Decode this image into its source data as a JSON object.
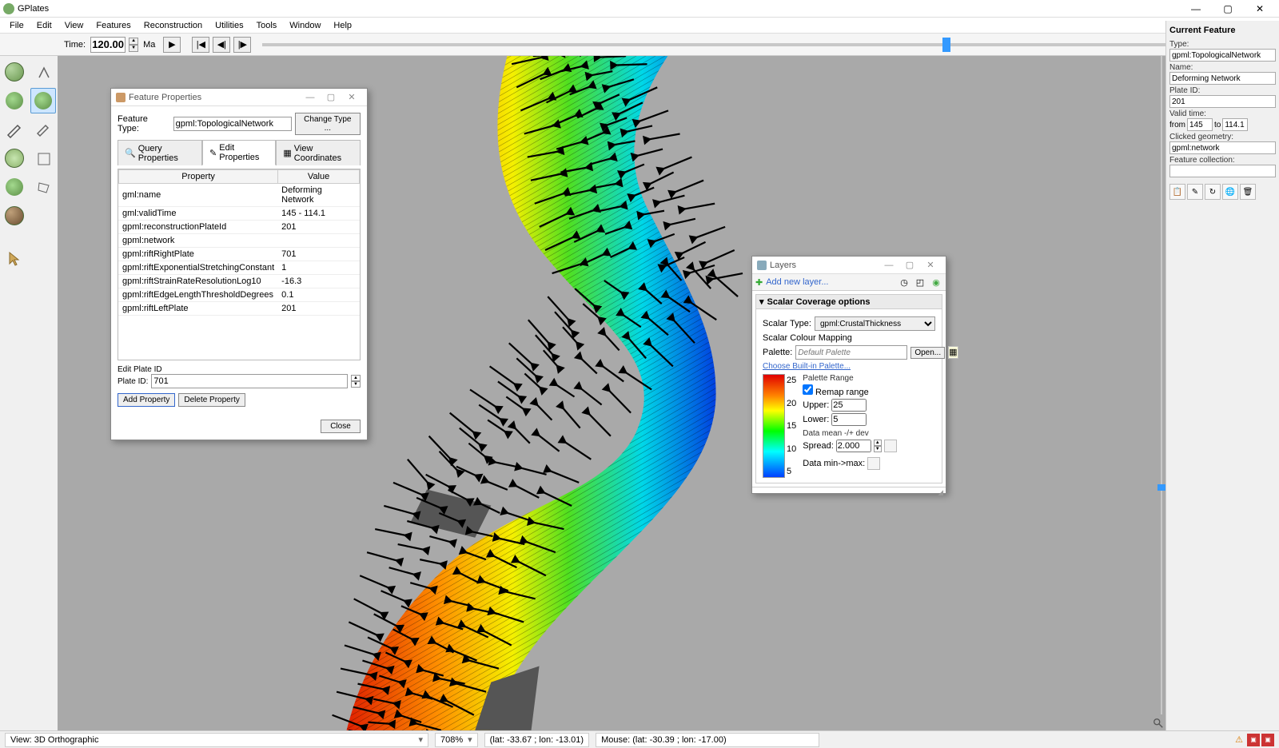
{
  "app": {
    "title": "GPlates"
  },
  "window_buttons": {
    "minimize": "—",
    "maximize": "▢",
    "close": "✕"
  },
  "menu": {
    "items": [
      "File",
      "Edit",
      "View",
      "Features",
      "Reconstruction",
      "Utilities",
      "Tools",
      "Window",
      "Help"
    ]
  },
  "time": {
    "label": "Time:",
    "value": "120.00",
    "unit": "Ma",
    "slider_pos_percent": 72
  },
  "left_tools_col1": [
    "globe3d",
    "africa1",
    "pen",
    "globe-wire",
    "africa2",
    "brown-sphere",
    "pointer"
  ],
  "left_tools_col2": [
    "compass",
    "africa-shade",
    "pen2",
    "wire2",
    "poly"
  ],
  "feature_props": {
    "dialog_title": "Feature Properties",
    "feature_type_label": "Feature Type:",
    "feature_type_value": "gpml:TopologicalNetwork",
    "change_type_btn": "Change Type ...",
    "tabs": {
      "query": "Query Properties",
      "edit": "Edit Properties",
      "view": "View Coordinates"
    },
    "columns": {
      "property": "Property",
      "value": "Value"
    },
    "rows": [
      {
        "p": "gml:name",
        "v": "Deforming Network"
      },
      {
        "p": "gml:validTime",
        "v": "145 - 114.1"
      },
      {
        "p": "gpml:reconstructionPlateId",
        "v": "201"
      },
      {
        "p": "gpml:network",
        "v": ""
      },
      {
        "p": "gpml:riftRightPlate",
        "v": "701"
      },
      {
        "p": "gpml:riftExponentialStretchingConstant",
        "v": "1"
      },
      {
        "p": "gpml:riftStrainRateResolutionLog10",
        "v": "-16.3"
      },
      {
        "p": "gpml:riftEdgeLengthThresholdDegrees",
        "v": "0.1"
      },
      {
        "p": "gpml:riftLeftPlate",
        "v": "201"
      }
    ],
    "edit_plate_label": "Edit Plate ID",
    "plate_id_label": "Plate ID:",
    "plate_id_value": "701",
    "add_property_btn": "Add Property",
    "delete_property_btn": "Delete Property",
    "close_btn": "Close"
  },
  "layers": {
    "dialog_title": "Layers",
    "add_new_layer": "Add new layer...",
    "panel_title": "Scalar Coverage options",
    "scalar_type_label": "Scalar Type:",
    "scalar_type_value": "gpml:CrustalThickness",
    "scalar_colour_mapping": "Scalar Colour Mapping",
    "palette_label": "Palette:",
    "palette_placeholder": "Default Palette",
    "open_btn": "Open...",
    "choose_builtin": "Choose Built-in Palette...",
    "ticks": [
      "25",
      "20",
      "15",
      "10",
      "5"
    ],
    "palette_range_label": "Palette Range",
    "remap_range": "Remap range",
    "upper_label": "Upper:",
    "upper_value": "25",
    "lower_label": "Lower:",
    "lower_value": "5",
    "data_mean_dev": "Data mean -/+ dev",
    "spread_label": "Spread:",
    "spread_value": "2.000",
    "data_minmax": "Data min->max:"
  },
  "current_feature": {
    "header": "Current Feature",
    "type_label": "Type:",
    "type_value": "gpml:TopologicalNetwork",
    "name_label": "Name:",
    "name_value": "Deforming Network",
    "plate_id_label": "Plate ID:",
    "plate_id_value": "201",
    "valid_time_label": "Valid time:",
    "from_label": "from",
    "from_value": "145",
    "to_label": "to",
    "to_value": "114.1",
    "clicked_geometry_label": "Clicked geometry:",
    "clicked_geometry_value": "gpml:network",
    "feature_collection_label": "Feature collection:",
    "feature_collection_value": ""
  },
  "statusbar": {
    "view_label": "View:",
    "view_value": "3D Orthographic",
    "zoom_value": "708%",
    "latlon": "(lat: -33.67 ; lon: -13.01)",
    "mouse": "Mouse: (lat: -30.39 ; lon: -17.00)"
  },
  "chart_data": {
    "type": "colorbar",
    "title": "gpml:CrustalThickness",
    "range": [
      5,
      25
    ],
    "ticks": [
      5,
      10,
      15,
      20,
      25
    ],
    "colormap": "rainbow (red=25, blue=5)"
  }
}
